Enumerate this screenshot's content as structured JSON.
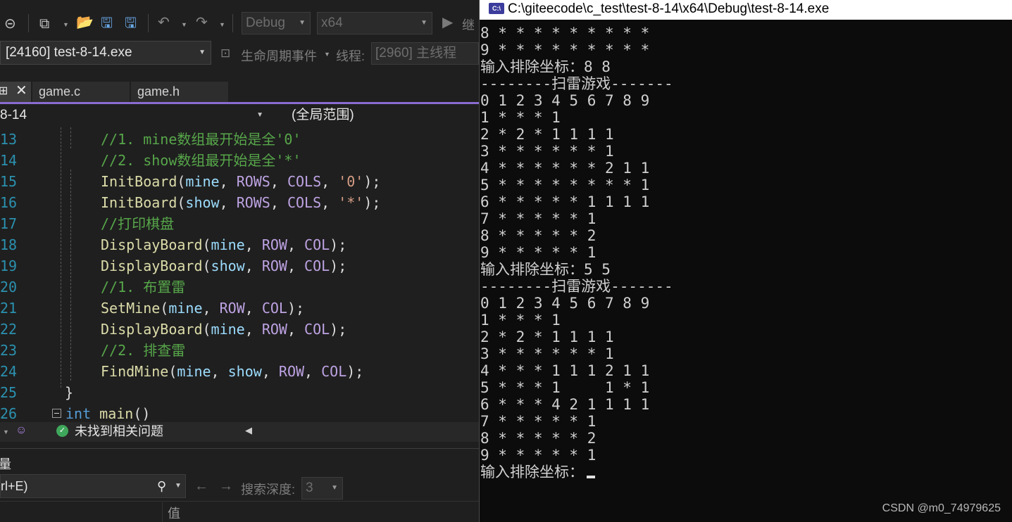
{
  "ide": {
    "toolbar": {
      "config": "Debug",
      "platform": "x64",
      "continue_label": "继"
    },
    "process": "[24160] test-8-14.exe",
    "lifecycle_label": "生命周期事件",
    "thread_label": "线程:",
    "thread_value": "[2960] 主线程",
    "tabs": [
      {
        "label": "game.c"
      },
      {
        "label": "game.h"
      }
    ],
    "pin_icon": "pin-icon",
    "nav": {
      "project": "8-14",
      "scope": "(全局范围)"
    },
    "code": {
      "line_numbers": [
        "13",
        "14",
        "15",
        "16",
        "17",
        "18",
        "19",
        "20",
        "21",
        "22",
        "23",
        "24",
        "25",
        "26"
      ],
      "closing_brace": "}"
    },
    "status": {
      "issues_text": "未找到相关问题"
    },
    "bottom_panel": {
      "title_fragment": "量",
      "search_value": "rl+E)",
      "depth_label": "搜索深度:",
      "depth_value": "3",
      "value_header": "值"
    }
  },
  "console": {
    "title": "C:\\giteecode\\c_test\\test-8-14\\x64\\Debug\\test-8-14.exe",
    "icon_text": "C:\\",
    "lines": [
      "8 * * * * * * * * *",
      "9 * * * * * * * * *",
      "输入排除坐标：8 8",
      "--------扫雷游戏-------",
      "0 1 2 3 4 5 6 7 8 9",
      "1 * * * 1",
      "2 * 2 * 1 1 1 1",
      "3 * * * * * * 1",
      "4 * * * * * * 2 1 1",
      "5 * * * * * * * * 1",
      "6 * * * * * 1 1 1 1",
      "7 * * * * * 1",
      "8 * * * * * 2",
      "9 * * * * * 1",
      "输入排除坐标：5 5",
      "--------扫雷游戏-------",
      "0 1 2 3 4 5 6 7 8 9",
      "1 * * * 1",
      "2 * 2 * 1 1 1 1",
      "3 * * * * * * 1",
      "4 * * * 1 1 1 2 1 1",
      "5 * * * 1     1 * 1",
      "6 * * * 4 2 1 1 1 1",
      "7 * * * * * 1",
      "8 * * * * * 2",
      "9 * * * * * 1"
    ],
    "prompt": "输入排除坐标："
  },
  "watermark": "CSDN @m0_74979625"
}
